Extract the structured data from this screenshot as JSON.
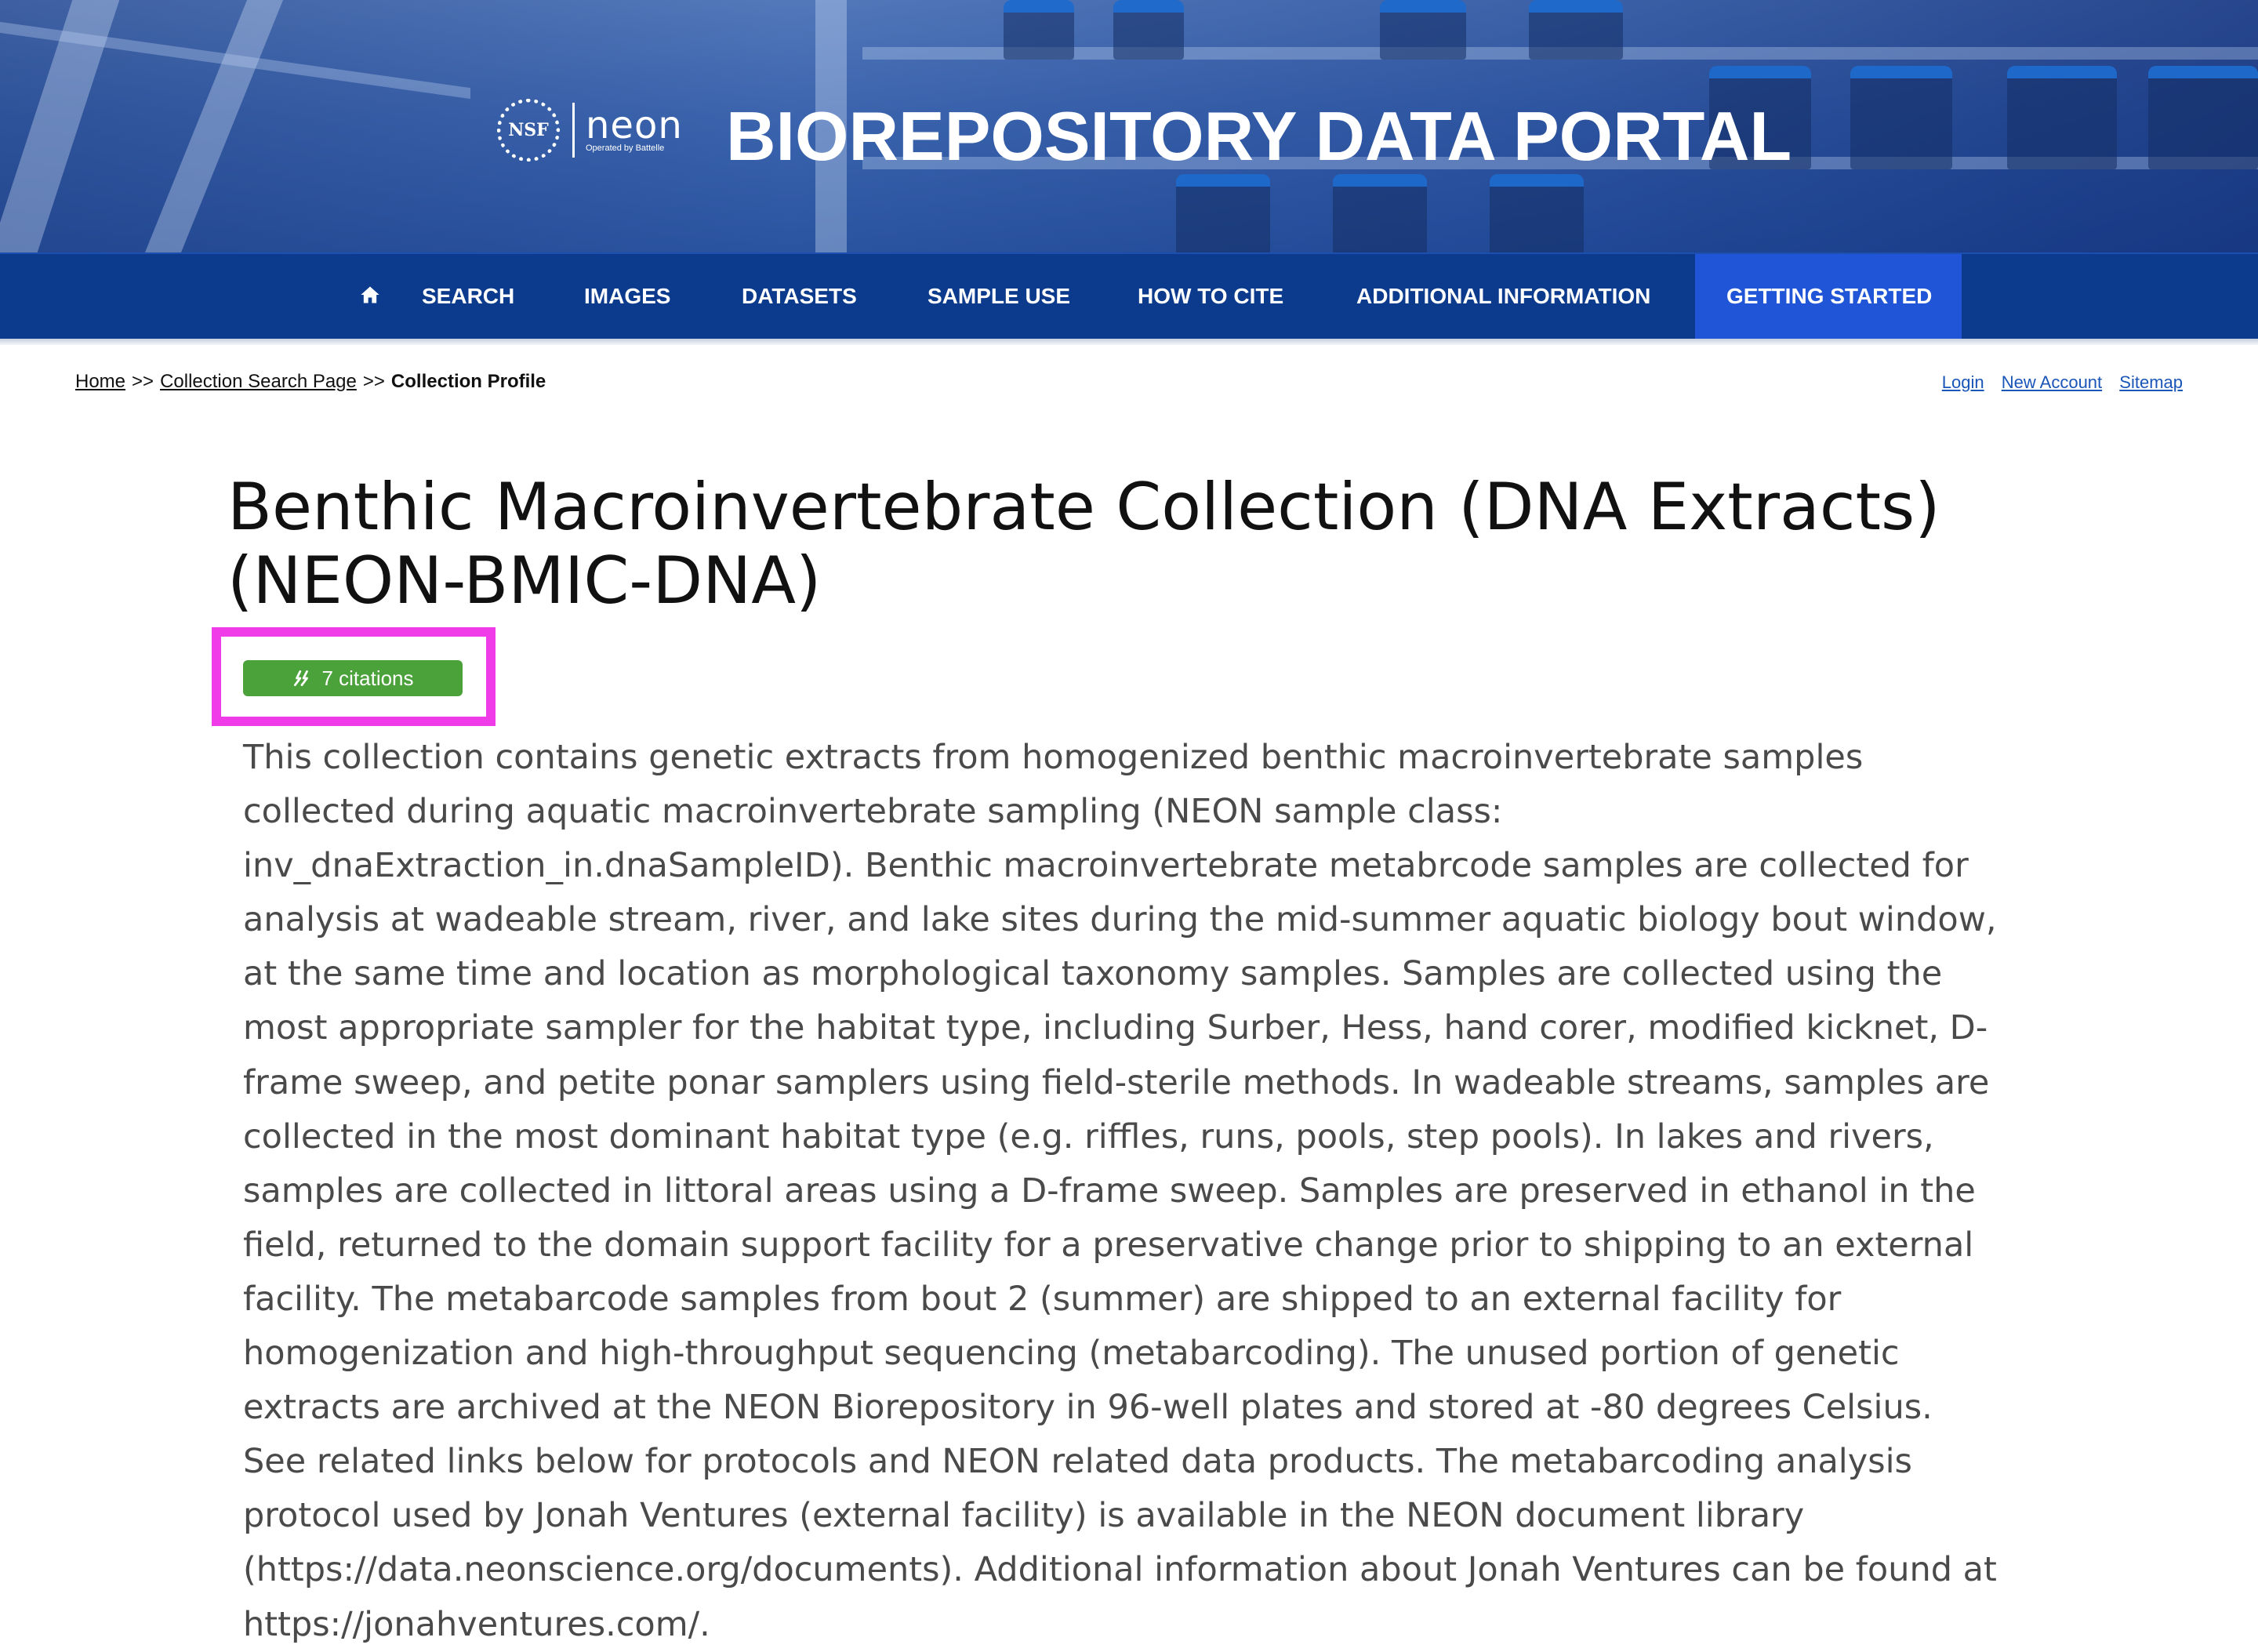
{
  "banner": {
    "logo_nsf": "NSF",
    "logo_neon": "neon",
    "logo_neon_sub": "Operated by Battelle",
    "site_title": "BIOREPOSITORY DATA PORTAL"
  },
  "nav": {
    "home_icon": "home-icon",
    "items": [
      {
        "label": "SEARCH"
      },
      {
        "label": "IMAGES"
      },
      {
        "label": "DATASETS"
      },
      {
        "label": "SAMPLE USE"
      },
      {
        "label": "HOW TO CITE"
      },
      {
        "label": "ADDITIONAL INFORMATION"
      },
      {
        "label": "GETTING STARTED",
        "active": true
      }
    ],
    "active_color": "#1f55d6",
    "bar_color": "#0c3a8c"
  },
  "breadcrumb": {
    "home": "Home",
    "separator": ">>",
    "collection_search": "Collection Search Page",
    "current": "Collection Profile"
  },
  "user_links": {
    "login": "Login",
    "new_account": "New Account",
    "sitemap": "Sitemap"
  },
  "collection": {
    "title": "Benthic Macroinvertebrate Collection (DNA Extracts) (NEON-BMIC-DNA)",
    "citations_label": "7 citations",
    "citations_icon": "quote-icon",
    "citation_color": "#4ba13a",
    "highlight_color": "#f03ce8",
    "description": "This collection contains genetic extracts from homogenized benthic macroinvertebrate samples collected during aquatic macroinvertebrate sampling (NEON sample class: inv_dnaExtraction_in.dnaSampleID). Benthic macroinvertebrate metabrcode samples are collected for analysis at wadeable stream, river, and lake sites during the mid-summer aquatic biology bout window, at the same time and location as morphological taxonomy samples. Samples are collected using the most appropriate sampler for the habitat type, including Surber, Hess, hand corer, modified kicknet, D-frame sweep, and petite ponar samplers using field-sterile methods. In wadeable streams, samples are collected in the most dominant habitat type (e.g. riffles, runs, pools, step pools). In lakes and rivers, samples are collected in littoral areas using a D-frame sweep. Samples are preserved in ethanol in the field, returned to the domain support facility for a preservative change prior to shipping to an external facility. The metabarcode samples from bout 2 (summer) are shipped to an external facility for homogenization and high-throughput sequencing (metabarcoding). The unused portion of genetic extracts are archived at the NEON Biorepository in 96-well plates and stored at -80 degrees Celsius. See related links below for protocols and NEON related data products. The metabarcoding analysis protocol used by Jonah Ventures (external facility) is available in the NEON document library (https://data.neonscience.org/documents). Additional information about Jonah Ventures can be found at https://jonahventures.com/."
  }
}
